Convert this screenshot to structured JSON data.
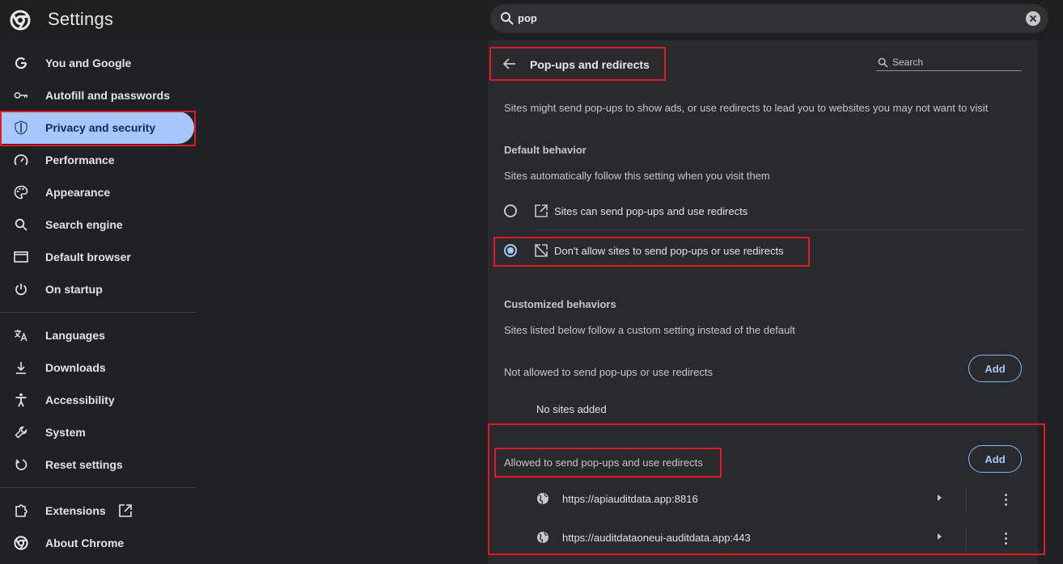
{
  "app": {
    "title": "Settings"
  },
  "search": {
    "value": "pop"
  },
  "sidebar": {
    "items": [
      {
        "label": "You and Google",
        "icon": "google-g-icon"
      },
      {
        "label": "Autofill and passwords",
        "icon": "key-icon"
      },
      {
        "label": "Privacy and security",
        "icon": "shield-icon",
        "active": true
      },
      {
        "label": "Performance",
        "icon": "speedometer-icon"
      },
      {
        "label": "Appearance",
        "icon": "palette-icon"
      },
      {
        "label": "Search engine",
        "icon": "search-icon"
      },
      {
        "label": "Default browser",
        "icon": "browser-window-icon"
      },
      {
        "label": "On startup",
        "icon": "power-icon"
      },
      {
        "label": "Languages",
        "icon": "translate-icon"
      },
      {
        "label": "Downloads",
        "icon": "download-icon"
      },
      {
        "label": "Accessibility",
        "icon": "accessibility-icon"
      },
      {
        "label": "System",
        "icon": "wrench-icon"
      },
      {
        "label": "Reset settings",
        "icon": "reset-icon"
      },
      {
        "label": "Extensions",
        "icon": "puzzle-icon"
      },
      {
        "label": "About Chrome",
        "icon": "chrome-icon"
      }
    ]
  },
  "panel": {
    "title": "Pop-ups and redirects",
    "search_placeholder": "Search",
    "description": "Sites might send pop-ups to show ads, or use redirects to lead you to websites you may not want to visit",
    "default_behavior": {
      "heading": "Default behavior",
      "subtext": "Sites automatically follow this setting when you visit them",
      "options": [
        {
          "label": "Sites can send pop-ups and use redirects",
          "icon": "open-in-new-icon",
          "selected": false
        },
        {
          "label": "Don't allow sites to send pop-ups or use redirects",
          "icon": "block-popup-icon",
          "selected": true
        }
      ]
    },
    "customized": {
      "heading": "Customized behaviors",
      "subtext": "Sites listed below follow a custom setting instead of the default",
      "blocked": {
        "label": "Not allowed to send pop-ups or use redirects",
        "add_label": "Add",
        "empty_text": "No sites added"
      },
      "allowed": {
        "label": "Allowed to send pop-ups and use redirects",
        "add_label": "Add",
        "sites": [
          "https://apiauditdata.app:8816",
          "https://auditdataoneui-auditdata.app:443"
        ]
      }
    }
  },
  "colors": {
    "accent": "#a8c7fa",
    "highlight": "#e01b24",
    "panel_bg": "#292a2d"
  }
}
